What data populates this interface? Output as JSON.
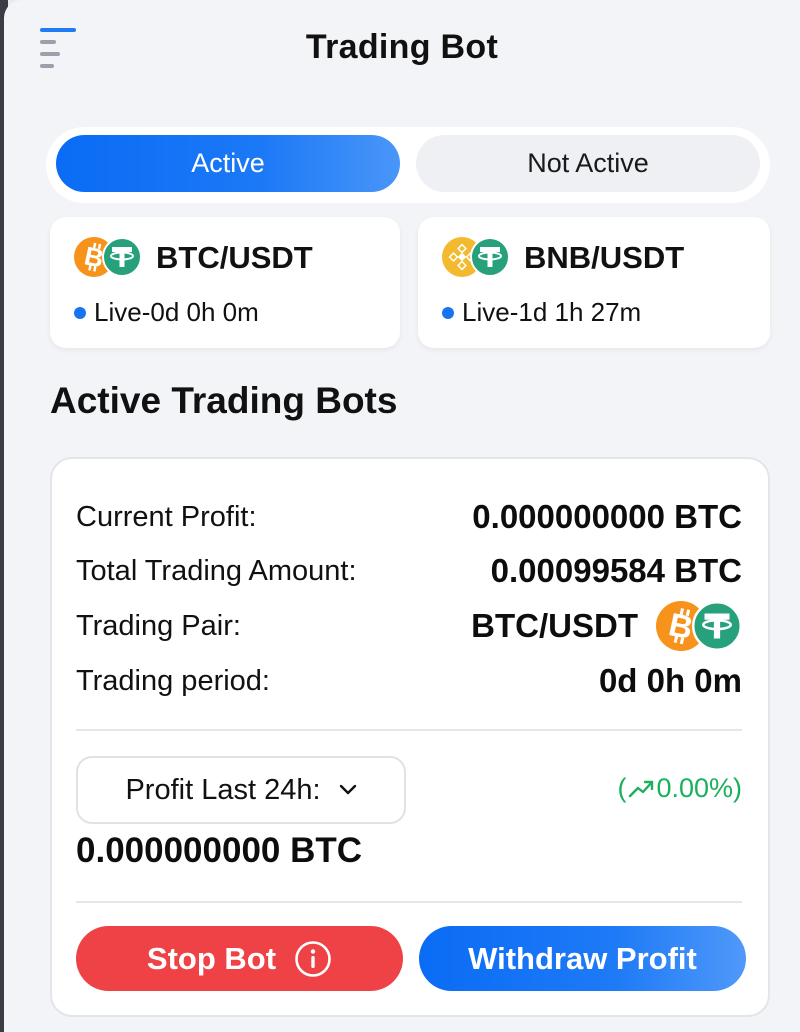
{
  "header": {
    "title": "Trading Bot",
    "menu_icon": "menu-icon"
  },
  "tabs": [
    {
      "label": "Active",
      "selected": true
    },
    {
      "label": "Not Active",
      "selected": false
    }
  ],
  "pairs": [
    {
      "name": "BTC/USDT",
      "status": "Live-0d 0h 0m",
      "icons": [
        "bitcoin-icon",
        "tether-icon"
      ]
    },
    {
      "name": "BNB/USDT",
      "status": "Live-1d 1h 27m",
      "icons": [
        "bnb-icon",
        "tether-icon"
      ]
    }
  ],
  "section_title": "Active Trading Bots",
  "bot": {
    "current_profit_label": "Current Profit:",
    "current_profit_value": "0.000000000 BTC",
    "total_amount_label": "Total Trading Amount:",
    "total_amount_value": "0.00099584 BTC",
    "pair_label": "Trading Pair:",
    "pair_value": "BTC/USDT",
    "period_label": "Trading period:",
    "period_value": "0d 0h 0m",
    "profit_select_label": "Profit Last 24h:",
    "change_open": "(",
    "change_value": "0.00%)",
    "profit_24h_value": "0.000000000 BTC",
    "stop_label": "Stop Bot",
    "withdraw_label": "Withdraw Profit"
  },
  "colors": {
    "accent": "#1674f1",
    "stop": "#ef4246",
    "positive": "#1bb15b",
    "bitcoin": "#f7931a",
    "tether": "#26a17b",
    "bnb": "#f3ba2f"
  }
}
